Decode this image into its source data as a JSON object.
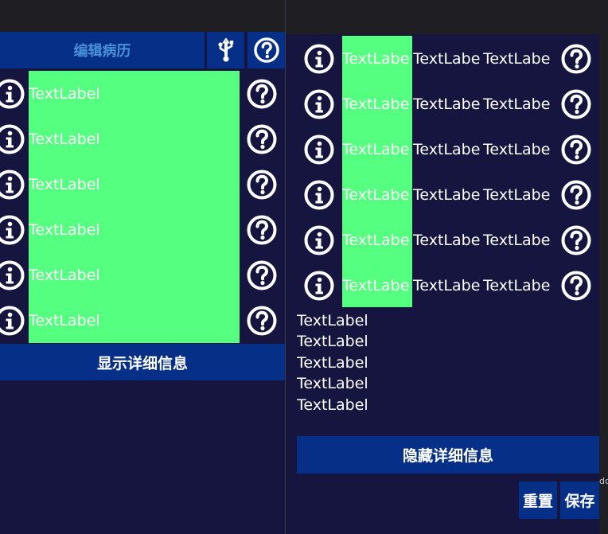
{
  "left_panel": {
    "edit_button": "编辑病历",
    "rows": [
      {
        "label": "TextLabel"
      },
      {
        "label": "TextLabel"
      },
      {
        "label": "TextLabel"
      },
      {
        "label": "TextLabel"
      },
      {
        "label": "TextLabel"
      },
      {
        "label": "TextLabel"
      }
    ],
    "show_details_button": "显示详细信息"
  },
  "right_panel": {
    "rows": [
      {
        "col1": "TextLabe",
        "col2": "TextLabe",
        "col3": "TextLabe"
      },
      {
        "col1": "TextLabe",
        "col2": "TextLabe",
        "col3": "TextLabe"
      },
      {
        "col1": "TextLabe",
        "col2": "TextLabe",
        "col3": "TextLabe"
      },
      {
        "col1": "TextLabe",
        "col2": "TextLabe",
        "col3": "TextLabe"
      },
      {
        "col1": "TextLabe",
        "col2": "TextLabe",
        "col3": "TextLabe"
      },
      {
        "col1": "TextLabe",
        "col2": "TextLabe",
        "col3": "TextLabe"
      }
    ],
    "detail_labels": [
      "TextLabel",
      "TextLabel",
      "TextLabel",
      "TextLabel",
      "TextLabel"
    ],
    "hide_details_button": "隐藏详细信息",
    "reset_button": "重置",
    "save_button": "保存"
  },
  "edge_text": "dc",
  "colors": {
    "background": "#151540",
    "button_blue": "#063088",
    "highlight_green": "#55ff7f",
    "edit_text": "#4a90d9",
    "titlebar": "#1f1e22"
  },
  "icons": {
    "info": "info-icon",
    "help": "help-icon",
    "usb": "usb-icon"
  }
}
